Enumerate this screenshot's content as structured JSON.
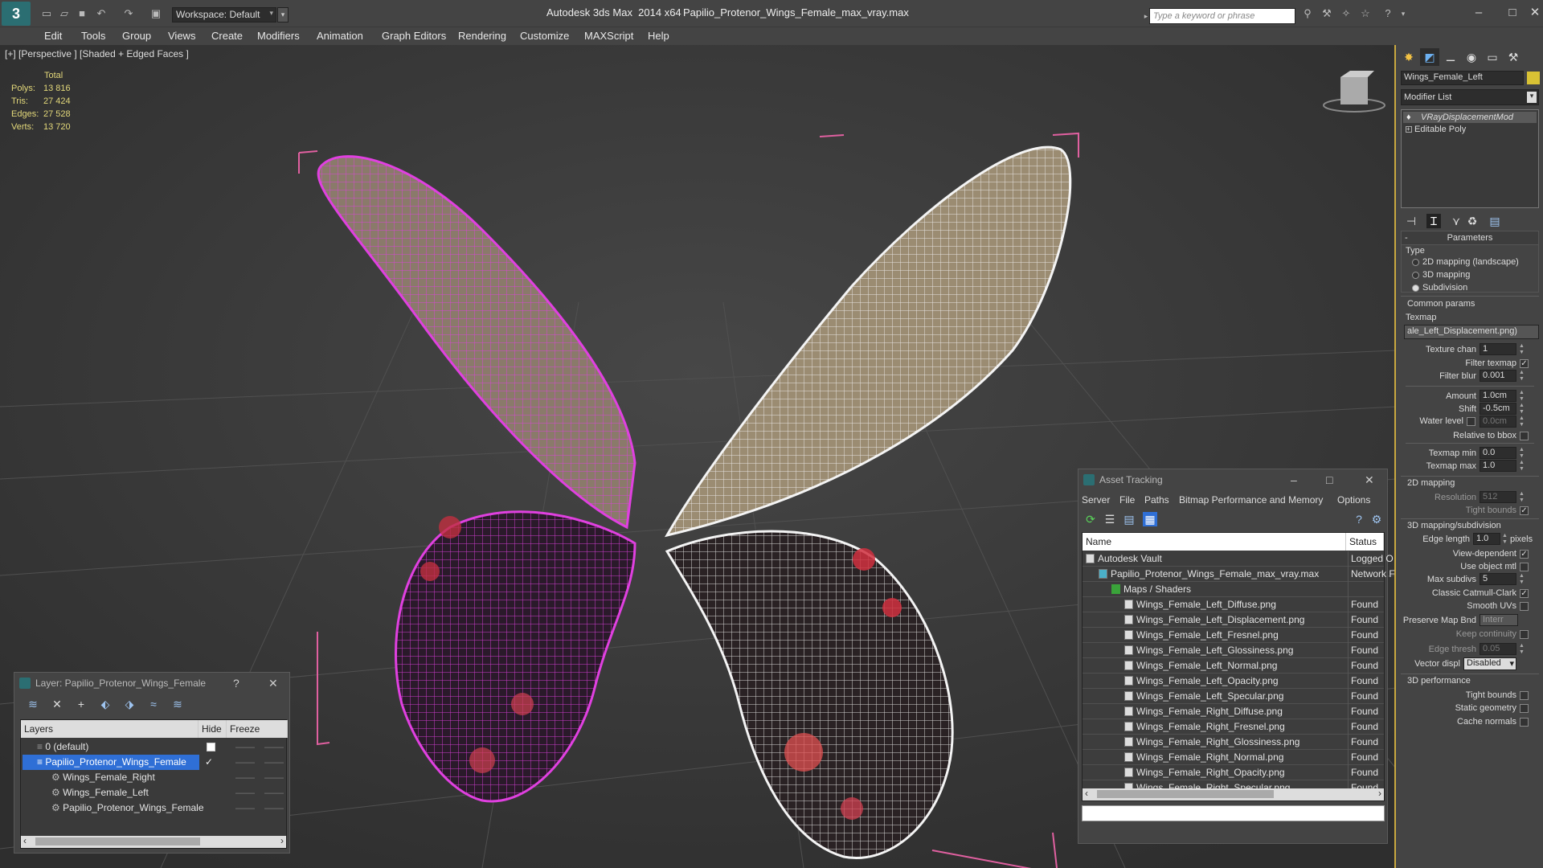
{
  "app": {
    "title": "Autodesk 3ds Max  2014 x64",
    "file": "Papilio_Protenor_Wings_Female_max_vray.max",
    "workspace": "Workspace: Default",
    "search_placeholder": "Type a keyword or phrase"
  },
  "menu": [
    "Edit",
    "Tools",
    "Group",
    "Views",
    "Create",
    "Modifiers",
    "Animation",
    "Graph Editors",
    "Rendering",
    "Customize",
    "MAXScript",
    "Help"
  ],
  "viewport": {
    "label": "[+] [Perspective ] [Shaded + Edged Faces ]",
    "stats": {
      "header": "Total",
      "rows": [
        {
          "label": "Polys:",
          "value": "13 816"
        },
        {
          "label": "Tris:",
          "value": "27 424"
        },
        {
          "label": "Edges:",
          "value": "27 528"
        },
        {
          "label": "Verts:",
          "value": "13 720"
        }
      ]
    }
  },
  "layer_panel": {
    "title": "Layer: Papilio_Protenor_Wings_Female",
    "help": "?",
    "columns": {
      "layers": "Layers",
      "hide": "Hide",
      "freeze": "Freeze"
    },
    "rows": [
      {
        "name": "0 (default)",
        "indent": 1,
        "selected": false
      },
      {
        "name": "Papilio_Protenor_Wings_Female",
        "indent": 1,
        "selected": true
      },
      {
        "name": "Wings_Female_Right",
        "indent": 2,
        "selected": false
      },
      {
        "name": "Wings_Female_Left",
        "indent": 2,
        "selected": false
      },
      {
        "name": "Papilio_Protenor_Wings_Female",
        "indent": 2,
        "selected": false
      }
    ]
  },
  "asset_tracking": {
    "title": "Asset Tracking",
    "menu": [
      "Server",
      "File",
      "Paths",
      "Bitmap Performance and Memory",
      "Options"
    ],
    "columns": {
      "name": "Name",
      "status": "Status"
    },
    "rows": [
      {
        "name": "Autodesk Vault",
        "status": "Logged O",
        "indent": 1
      },
      {
        "name": "Papilio_Protenor_Wings_Female_max_vray.max",
        "status": "Network F",
        "indent": 2
      },
      {
        "name": "Maps / Shaders",
        "status": "",
        "indent": 3
      },
      {
        "name": "Wings_Female_Left_Diffuse.png",
        "status": "Found",
        "indent": 4
      },
      {
        "name": "Wings_Female_Left_Displacement.png",
        "status": "Found",
        "indent": 4
      },
      {
        "name": "Wings_Female_Left_Fresnel.png",
        "status": "Found",
        "indent": 4
      },
      {
        "name": "Wings_Female_Left_Glossiness.png",
        "status": "Found",
        "indent": 4
      },
      {
        "name": "Wings_Female_Left_Normal.png",
        "status": "Found",
        "indent": 4
      },
      {
        "name": "Wings_Female_Left_Opacity.png",
        "status": "Found",
        "indent": 4
      },
      {
        "name": "Wings_Female_Left_Specular.png",
        "status": "Found",
        "indent": 4
      },
      {
        "name": "Wings_Female_Right_Diffuse.png",
        "status": "Found",
        "indent": 4
      },
      {
        "name": "Wings_Female_Right_Fresnel.png",
        "status": "Found",
        "indent": 4
      },
      {
        "name": "Wings_Female_Right_Glossiness.png",
        "status": "Found",
        "indent": 4
      },
      {
        "name": "Wings_Female_Right_Normal.png",
        "status": "Found",
        "indent": 4
      },
      {
        "name": "Wings_Female_Right_Opacity.png",
        "status": "Found",
        "indent": 4
      },
      {
        "name": "Wings_Female_Right_Specular.png",
        "status": "Found",
        "indent": 4
      }
    ]
  },
  "command_panel": {
    "object_name": "Wings_Female_Left",
    "modifier_list": "Modifier List",
    "stack": [
      "VRayDisplacementMod",
      "Editable Poly"
    ],
    "parameters": "Parameters",
    "type_label": "Type",
    "type_options": [
      {
        "label": "2D mapping (landscape)",
        "selected": false
      },
      {
        "label": "3D mapping",
        "selected": false
      },
      {
        "label": "Subdivision",
        "selected": true
      }
    ],
    "common_params": "Common params",
    "texmap_label": "Texmap",
    "texmap": "ale_Left_Displacement.png)",
    "texture_chan": {
      "label": "Texture chan",
      "value": "1"
    },
    "filter_texmap": {
      "label": "Filter texmap",
      "checked": true
    },
    "filter_blur": {
      "label": "Filter blur",
      "value": "0.001"
    },
    "amount": {
      "label": "Amount",
      "value": "1.0cm"
    },
    "shift": {
      "label": "Shift",
      "value": "-0.5cm"
    },
    "water_level": {
      "label": "Water level",
      "value": "0.0cm"
    },
    "relative_bbox": {
      "label": "Relative to bbox",
      "checked": false
    },
    "texmap_min": {
      "label": "Texmap min",
      "value": "0.0"
    },
    "texmap_max": {
      "label": "Texmap max",
      "value": "1.0"
    },
    "mapping_2d": "2D mapping",
    "resolution": {
      "label": "Resolution",
      "value": "512"
    },
    "tight_bounds": {
      "label": "Tight bounds",
      "checked": true
    },
    "mapping_3d": "3D mapping/subdivision",
    "edge_length": {
      "label": "Edge length",
      "value": "1.0",
      "unit": "pixels"
    },
    "view_dependent": {
      "label": "View-dependent",
      "checked": true
    },
    "use_object_mtl": {
      "label": "Use object mtl",
      "checked": false
    },
    "max_subdivs": {
      "label": "Max subdivs",
      "value": "5"
    },
    "catmull": {
      "label": "Classic Catmull-Clark",
      "checked": true
    },
    "smooth_uvs": {
      "label": "Smooth UVs",
      "checked": false
    },
    "preserve_map": {
      "label": "Preserve Map Bnd",
      "value": "Interr"
    },
    "keep_continuity": {
      "label": "Keep continuity",
      "checked": false
    },
    "edge_thresh": {
      "label": "Edge thresh",
      "value": "0.05"
    },
    "vector_displ": {
      "label": "Vector displ",
      "value": "Disabled"
    },
    "performance": "3D performance",
    "perf_tight_bounds": {
      "label": "Tight bounds",
      "checked": false
    },
    "static_geometry": {
      "label": "Static geometry",
      "checked": false
    },
    "cache_normals": {
      "label": "Cache normals",
      "checked": false
    }
  }
}
